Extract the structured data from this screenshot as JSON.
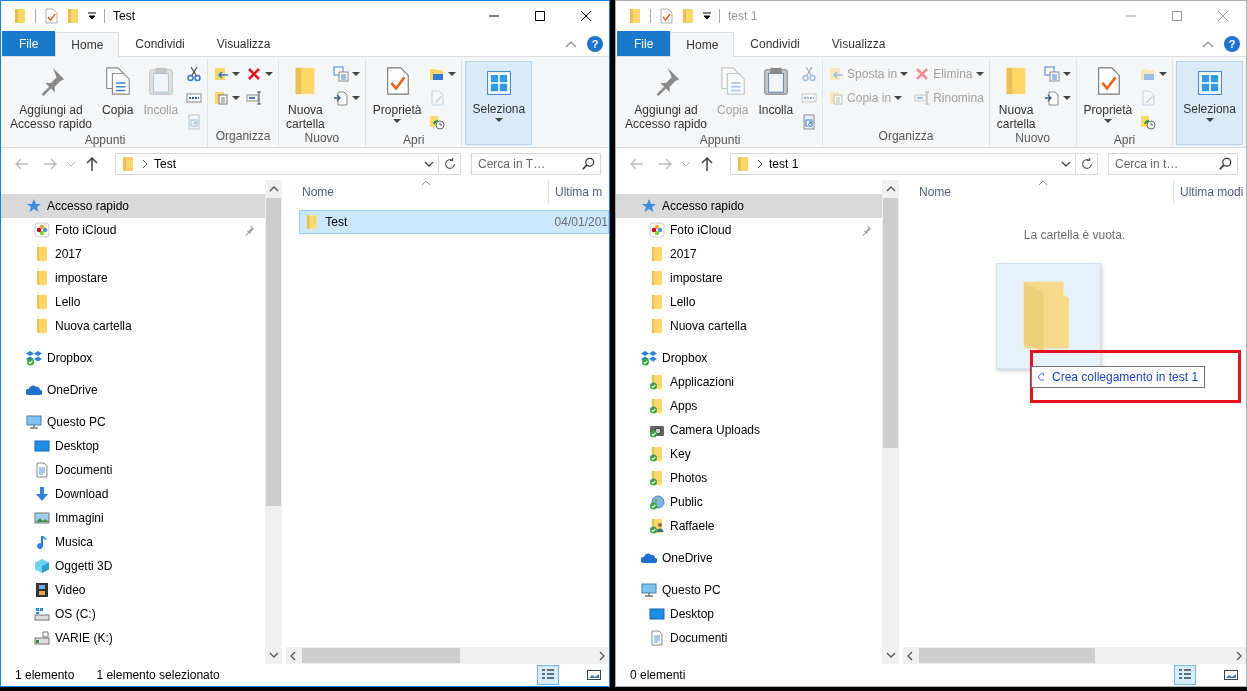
{
  "windows": [
    {
      "title": "Test",
      "active": true,
      "help_label": "?",
      "tabs": [
        {
          "label": "File",
          "kind": "file",
          "selected": false
        },
        {
          "label": "Home",
          "kind": "tab",
          "selected": true
        },
        {
          "label": "Condividi",
          "kind": "tab",
          "selected": false
        },
        {
          "label": "Visualizza",
          "kind": "tab",
          "selected": false
        }
      ],
      "ribbon": [
        {
          "label": "Appunti",
          "items": [
            {
              "kind": "large",
              "label": "Aggiungi ad\nAccesso rapido",
              "disabled": false
            },
            {
              "kind": "large",
              "label": "Copia",
              "disabled": false
            },
            {
              "kind": "large",
              "label": "Incolla",
              "disabled": true
            },
            {
              "kind": "small",
              "disabled": false
            },
            {
              "kind": "small",
              "disabled": false
            },
            {
              "kind": "small",
              "disabled": true
            }
          ]
        },
        {
          "label": "Organizza",
          "items": [
            {
              "kind": "small",
              "caret": true,
              "disabled": false
            },
            {
              "kind": "small",
              "caret": true,
              "disabled": false
            },
            {
              "kind": "small",
              "caret": true,
              "disabled": false
            },
            {
              "kind": "small",
              "disabled": false
            }
          ]
        },
        {
          "label": "Nuovo",
          "items": [
            {
              "kind": "large",
              "label": "Nuova\ncartella",
              "disabled": false
            },
            {
              "kind": "small",
              "caret": true,
              "disabled": false
            },
            {
              "kind": "small",
              "caret": true,
              "disabled": false
            }
          ]
        },
        {
          "label": "Apri",
          "items": [
            {
              "kind": "large",
              "label": "Proprietà",
              "caret": true,
              "disabled": false
            },
            {
              "kind": "small",
              "caret": true,
              "disabled": false
            },
            {
              "kind": "small",
              "disabled": true
            },
            {
              "kind": "small",
              "disabled": false
            }
          ]
        },
        {
          "items": [
            {
              "kind": "group",
              "label": "Seleziona",
              "caret": true
            }
          ]
        }
      ],
      "address": {
        "path": "Test"
      },
      "search": {
        "placeholder": "Cerca in T…"
      },
      "nav": [
        {
          "label": "Accesso rapido",
          "kind": "star",
          "selected": true,
          "children": [
            {
              "label": "Foto iCloud",
              "kind": "photos",
              "selected": false,
              "pinned": true
            },
            {
              "label": "2017",
              "kind": "folder",
              "selected": false,
              "pinned": false
            },
            {
              "label": "impostare",
              "kind": "folder",
              "selected": false,
              "pinned": false
            },
            {
              "label": "Lello",
              "kind": "folder",
              "selected": false,
              "pinned": false
            },
            {
              "label": "Nuova cartella",
              "kind": "folder",
              "selected": false,
              "pinned": false
            }
          ]
        },
        {
          "label": "Dropbox",
          "kind": "dropbox",
          "selected": false
        },
        {
          "label": "OneDrive",
          "kind": "onedrive",
          "selected": false
        },
        {
          "label": "Questo PC",
          "kind": "pc",
          "selected": false,
          "children": [
            {
              "label": "Desktop",
              "kind": "desktop",
              "selected": false
            },
            {
              "label": "Documenti",
              "kind": "documents",
              "selected": false
            },
            {
              "label": "Download",
              "kind": "download",
              "selected": false
            },
            {
              "label": "Immagini",
              "kind": "pictures",
              "selected": false
            },
            {
              "label": "Musica",
              "kind": "music",
              "selected": false
            },
            {
              "label": "Oggetti 3D",
              "kind": "objects3d",
              "selected": false
            },
            {
              "label": "Video",
              "kind": "video",
              "selected": false
            },
            {
              "label": "OS (C:)",
              "kind": "drive",
              "selected": false
            },
            {
              "label": "VARIE (K:)",
              "kind": "netdrive",
              "selected": false
            }
          ]
        }
      ],
      "columns": [
        {
          "label": "Nome"
        },
        {
          "label": "Ultima m"
        }
      ],
      "files": [
        {
          "name": "Test",
          "date": "04/01/201",
          "selected": true
        }
      ],
      "status": [
        "1 elemento",
        "1 elemento selezionato"
      ],
      "views": [
        {
          "selected": true
        },
        {
          "selected": false
        }
      ]
    },
    {
      "title": "test 1",
      "active": false,
      "help_label": "?",
      "tabs": [
        {
          "label": "File",
          "kind": "file",
          "selected": false
        },
        {
          "label": "Home",
          "kind": "tab",
          "selected": true
        },
        {
          "label": "Condividi",
          "kind": "tab",
          "selected": false
        },
        {
          "label": "Visualizza",
          "kind": "tab",
          "selected": false
        }
      ],
      "ribbon": [
        {
          "label": "Appunti",
          "items": [
            {
              "kind": "large",
              "label": "Aggiungi ad\nAccesso rapido",
              "disabled": false
            },
            {
              "kind": "large",
              "label": "Copia",
              "disabled": true
            },
            {
              "kind": "large",
              "label": "Incolla",
              "disabled": false
            },
            {
              "kind": "small",
              "disabled": true
            },
            {
              "kind": "small",
              "disabled": true
            },
            {
              "kind": "small",
              "disabled": false
            }
          ]
        },
        {
          "label": "Organizza",
          "items": [
            {
              "kind": "small",
              "label": "Sposta in",
              "caret": true,
              "disabled": true
            },
            {
              "kind": "small",
              "label": "Copia in",
              "caret": true,
              "disabled": true
            },
            {
              "kind": "small",
              "label": "Elimina",
              "caret": true,
              "disabled": true
            },
            {
              "kind": "small",
              "label": "Rinomina",
              "disabled": true
            }
          ]
        },
        {
          "label": "Nuovo",
          "items": [
            {
              "kind": "large",
              "label": "Nuova\ncartella",
              "disabled": false
            },
            {
              "kind": "small",
              "caret": true,
              "disabled": false
            },
            {
              "kind": "small",
              "caret": true,
              "disabled": false
            }
          ]
        },
        {
          "label": "Apri",
          "items": [
            {
              "kind": "large",
              "label": "Proprietà",
              "caret": true,
              "disabled": false
            },
            {
              "kind": "small",
              "caret": true,
              "disabled": true
            },
            {
              "kind": "small",
              "disabled": true
            },
            {
              "kind": "small",
              "disabled": false
            }
          ]
        },
        {
          "items": [
            {
              "kind": "group",
              "label": "Seleziona",
              "caret": true
            }
          ]
        }
      ],
      "address": {
        "path": "test 1"
      },
      "search": {
        "placeholder": "Cerca in t…"
      },
      "nav": [
        {
          "label": "Accesso rapido",
          "kind": "star",
          "selected": true,
          "children": [
            {
              "label": "Foto iCloud",
              "kind": "photos",
              "selected": false,
              "pinned": true
            },
            {
              "label": "2017",
              "kind": "folder",
              "selected": false,
              "pinned": false
            },
            {
              "label": "impostare",
              "kind": "folder",
              "selected": false,
              "pinned": false
            },
            {
              "label": "Lello",
              "kind": "folder",
              "selected": false,
              "pinned": false
            },
            {
              "label": "Nuova cartella",
              "kind": "folder",
              "selected": false,
              "pinned": false
            }
          ]
        },
        {
          "label": "Dropbox",
          "kind": "dropbox",
          "selected": false,
          "children": [
            {
              "label": "Applicazioni",
              "kind": "synced",
              "selected": false
            },
            {
              "label": "Apps",
              "kind": "synced",
              "selected": false
            },
            {
              "label": "Camera Uploads",
              "kind": "camera",
              "selected": false
            },
            {
              "label": "Key",
              "kind": "synced",
              "selected": false
            },
            {
              "label": "Photos",
              "kind": "synced",
              "selected": false
            },
            {
              "label": "Public",
              "kind": "public",
              "selected": false
            },
            {
              "label": "Raffaele",
              "kind": "user",
              "selected": false
            }
          ]
        },
        {
          "label": "OneDrive",
          "kind": "onedrive",
          "selected": false
        },
        {
          "label": "Questo PC",
          "kind": "pc",
          "selected": false,
          "children": [
            {
              "label": "Desktop",
              "kind": "desktop",
              "selected": false
            },
            {
              "label": "Documenti",
              "kind": "documents",
              "selected": false
            }
          ]
        }
      ],
      "columns": [
        {
          "label": "Nome"
        },
        {
          "label": "Ultima modi"
        }
      ],
      "empty_message": "La cartella è vuota.",
      "drag": {
        "tooltip": "Crea collegamento in test 1"
      },
      "status": [
        "0 elementi"
      ],
      "views": [
        {
          "selected": true
        },
        {
          "selected": false
        }
      ]
    }
  ]
}
